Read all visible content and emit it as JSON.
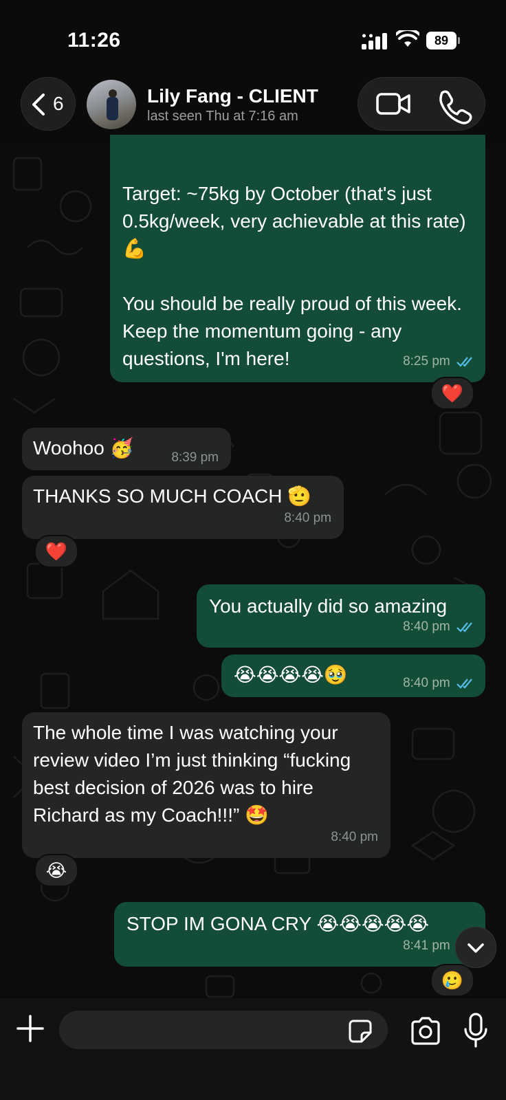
{
  "status_bar": {
    "time": "11:26",
    "battery": "89"
  },
  "header": {
    "back_count": "6",
    "contact_name": "Lily Fang - CLIENT",
    "last_seen": "last seen Thu at 7:16 am"
  },
  "messages": [
    {
      "direction": "out",
      "text": "Target: ~75kg by October (that's just 0.5kg/week, very achievable at this rate) 💪\n\nYou should be really proud of this week. Keep the momentum going - any questions, I'm here!",
      "time": "8:25 pm",
      "read": true,
      "reaction": "❤️"
    },
    {
      "direction": "in",
      "text": "Woohoo 🥳",
      "time": "8:39 pm"
    },
    {
      "direction": "in",
      "text": "THANKS SO MUCH COACH 🫡",
      "time": "8:40 pm",
      "reaction": "❤️"
    },
    {
      "direction": "out",
      "text": "You actually did so amazing",
      "time": "8:40 pm",
      "read": true
    },
    {
      "direction": "out",
      "text": "😭😭😭😭🥹",
      "time": "8:40 pm",
      "read": true
    },
    {
      "direction": "in",
      "text": "The whole time I was watching your review video I’m just thinking “fucking best decision of 2026 was to hire Richard as my Coach!!!” 🤩",
      "time": "8:40 pm",
      "reaction": "😭"
    },
    {
      "direction": "out",
      "text": "STOP IM GONA CRY 😭😭😭😭😭",
      "time": "8:41 pm",
      "read": true,
      "reaction": "🥲"
    }
  ],
  "composer": {
    "placeholder": ""
  },
  "colors": {
    "outgoing_bubble": "#144d37",
    "incoming_bubble": "#242626",
    "read_ticks": "#53bdeb",
    "background": "#0c0c0c"
  },
  "icons": [
    "chevron-left-icon",
    "video-camera-icon",
    "phone-icon",
    "plus-icon",
    "sticker-icon",
    "camera-icon",
    "microphone-icon",
    "chevron-down-icon",
    "double-check-icon"
  ]
}
